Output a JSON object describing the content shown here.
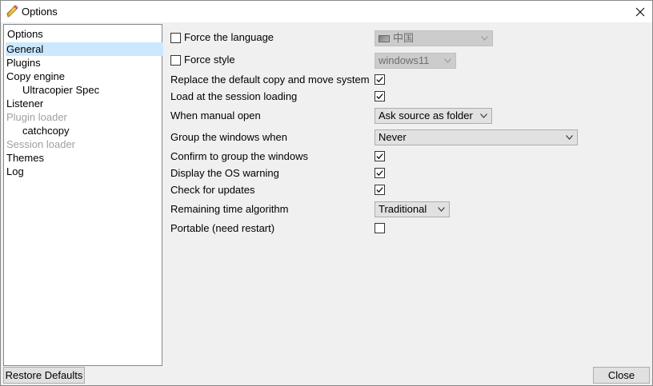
{
  "window": {
    "title": "Options",
    "app_icon": "ultracopier-pencil-icon",
    "close_icon": "close-icon"
  },
  "sidebar": {
    "header": "Options",
    "items": [
      {
        "label": "General",
        "selected": true,
        "level": 0,
        "enabled": true
      },
      {
        "label": "Plugins",
        "level": 0,
        "enabled": true
      },
      {
        "label": "Copy engine",
        "level": 0,
        "enabled": true
      },
      {
        "label": "Ultracopier Spec",
        "level": 1,
        "enabled": true
      },
      {
        "label": "Listener",
        "level": 0,
        "enabled": true
      },
      {
        "label": "Plugin loader",
        "level": 0,
        "enabled": false
      },
      {
        "label": "catchcopy",
        "level": 1,
        "enabled": true
      },
      {
        "label": "Session loader",
        "level": 0,
        "enabled": false
      },
      {
        "label": "Themes",
        "level": 0,
        "enabled": true
      },
      {
        "label": "Log",
        "level": 0,
        "enabled": true
      }
    ]
  },
  "general": {
    "force_language": {
      "label": "Force the language",
      "checked": false,
      "value": "中国"
    },
    "force_style": {
      "label": "Force style",
      "checked": false,
      "value": "windows11"
    },
    "replace_copy": {
      "label": "Replace the default copy and move system",
      "checked": true
    },
    "load_session": {
      "label": "Load at the session loading",
      "checked": true
    },
    "manual_open": {
      "label": "When manual open",
      "value": "Ask source as folder"
    },
    "group_windows": {
      "label": "Group the windows when",
      "value": "Never"
    },
    "confirm_group": {
      "label": "Confirm to group the windows",
      "checked": true
    },
    "os_warning": {
      "label": "Display the OS warning",
      "checked": true
    },
    "check_updates": {
      "label": "Check for updates",
      "checked": true
    },
    "remaining_time": {
      "label": "Remaining time algorithm",
      "value": "Traditional"
    },
    "portable": {
      "label": "Portable (need restart)",
      "checked": false
    }
  },
  "footer": {
    "restore_defaults": "Restore Defaults",
    "close": "Close"
  }
}
